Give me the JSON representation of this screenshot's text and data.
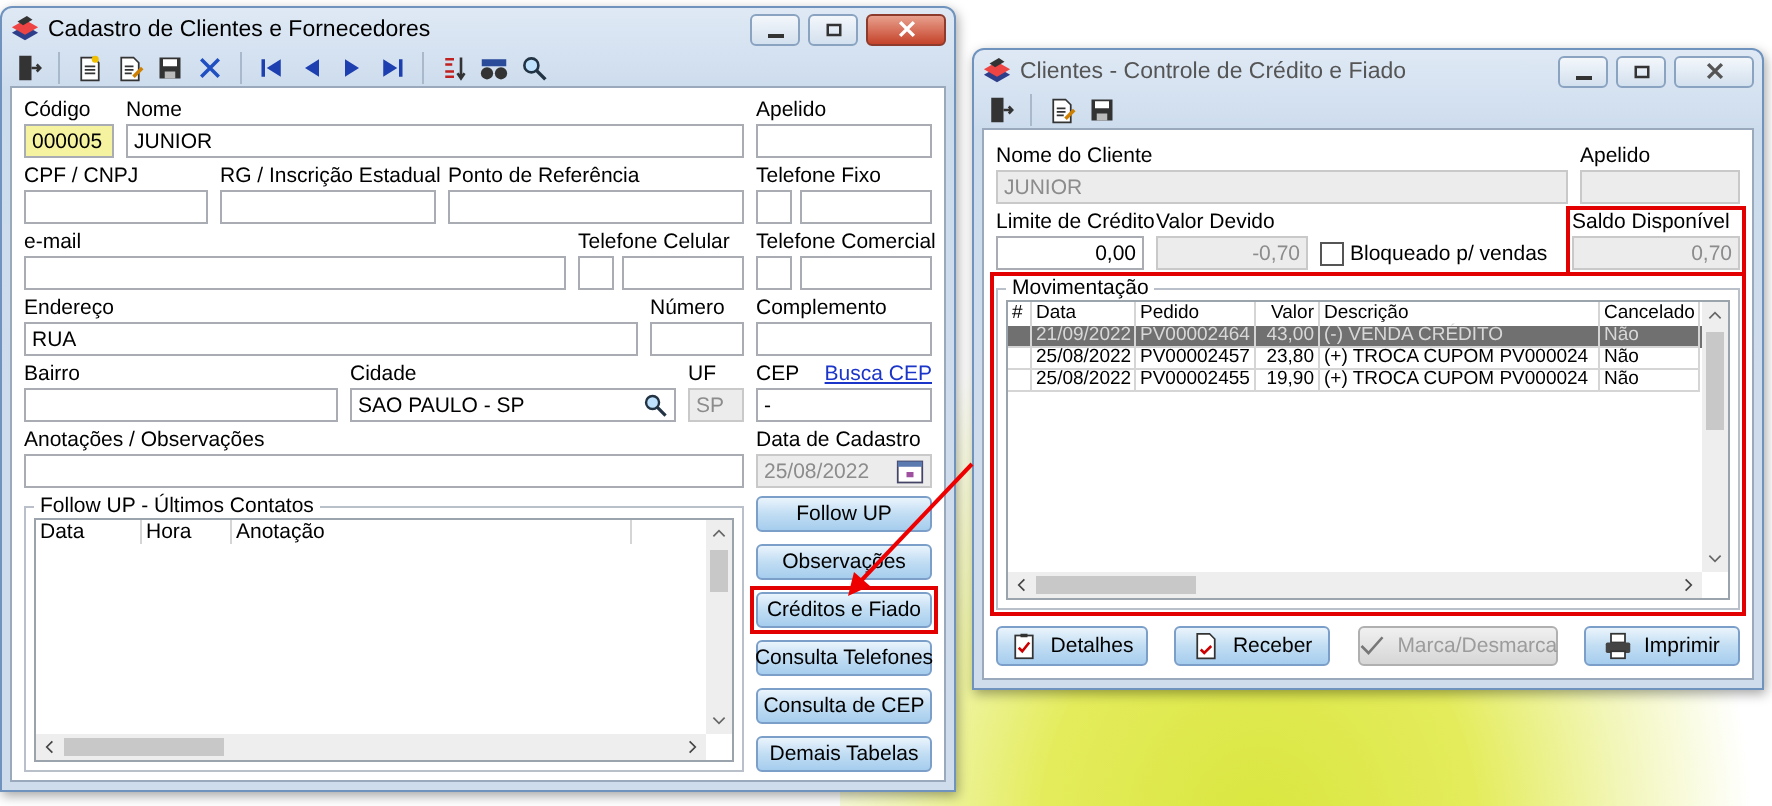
{
  "main_window": {
    "title": "Cadastro de Clientes e Fornecedores",
    "active": true,
    "fields": [
      {
        "label": "Código",
        "value": "000005",
        "kind": "text",
        "disabled": false,
        "focused": true
      },
      {
        "label": "Nome",
        "value": "JUNIOR",
        "kind": "text",
        "disabled": false,
        "focused": false
      },
      {
        "label": "Apelido",
        "kind": "text",
        "disabled": false,
        "focused": false
      },
      {
        "label": "CPF / CNPJ",
        "kind": "text",
        "disabled": false,
        "focused": false
      },
      {
        "label": "RG / Inscrição Estadual",
        "kind": "text",
        "disabled": false,
        "focused": false
      },
      {
        "label": "Ponto de Referência",
        "kind": "text",
        "disabled": false,
        "focused": false
      },
      {
        "label": "Telefone Fixo",
        "kind": "phone",
        "disabled": false,
        "focused": false
      },
      {
        "label": "e-mail",
        "kind": "text",
        "disabled": false,
        "focused": false
      },
      {
        "label": "Telefone Celular",
        "kind": "phone",
        "disabled": false,
        "focused": false
      },
      {
        "label": "Telefone Comercial",
        "kind": "phone",
        "disabled": false,
        "focused": false
      },
      {
        "label": "Endereço",
        "value": "RUA",
        "kind": "text",
        "disabled": false,
        "focused": false
      },
      {
        "label": "Número",
        "kind": "text",
        "disabled": false,
        "focused": false
      },
      {
        "label": "Complemento",
        "kind": "text",
        "disabled": false,
        "focused": false
      },
      {
        "label": "Bairro",
        "kind": "text",
        "disabled": false,
        "focused": false
      },
      {
        "label": "Cidade",
        "value": "SAO PAULO - SP",
        "kind": "search",
        "disabled": false,
        "focused": false
      },
      {
        "label": "UF",
        "value": "SP",
        "kind": "text",
        "disabled": true,
        "focused": false
      },
      {
        "label": "CEP",
        "value": "-",
        "link": "Busca CEP",
        "kind": "text",
        "disabled": false,
        "focused": false
      },
      {
        "label": "Anotações / Observações",
        "kind": "text",
        "disabled": false,
        "focused": false
      },
      {
        "label": "Data de Cadastro",
        "value": "25/08/2022",
        "kind": "date",
        "disabled": true,
        "focused": false
      }
    ],
    "followup": {
      "title": "Follow UP - Últimos Contatos",
      "columns": [
        "Data",
        "Hora",
        "Anotação"
      ]
    },
    "side_buttons": [
      {
        "label": "Follow UP",
        "highlighted": false
      },
      {
        "label": "Observações",
        "highlighted": false
      },
      {
        "label": "Créditos e Fiado",
        "highlighted": true
      },
      {
        "label": "Consulta Telefones",
        "highlighted": false
      },
      {
        "label": "Consulta de CEP",
        "highlighted": false
      },
      {
        "label": "Demais Tabelas",
        "highlighted": false
      }
    ]
  },
  "credit_window": {
    "title": "Clientes - Controle de Crédito e Fiado",
    "active": false,
    "fields": [
      {
        "label": "Nome do Cliente",
        "value": "JUNIOR",
        "kind": "text",
        "disabled": true,
        "highlighted": false
      },
      {
        "label": "Apelido",
        "kind": "text",
        "disabled": true,
        "highlighted": false
      },
      {
        "label": "Limite de Crédito",
        "value": "0,00",
        "kind": "number",
        "disabled": false,
        "highlighted": false
      },
      {
        "label": "Valor Devido",
        "value": "-0,70",
        "kind": "number",
        "disabled": true,
        "highlighted": false
      },
      {
        "label": "Bloqueado p/ vendas",
        "kind": "checkbox",
        "checked": false,
        "disabled": false,
        "highlighted": false
      },
      {
        "label": "Saldo Disponível",
        "value": "0,70",
        "kind": "number",
        "disabled": true,
        "highlighted": true
      }
    ],
    "movement": {
      "title": "Movimentação",
      "highlighted": true,
      "columns": [
        {
          "label": "#",
          "kind": "text"
        },
        {
          "label": "Data",
          "kind": "text"
        },
        {
          "label": "Pedido",
          "kind": "text"
        },
        {
          "label": "Valor",
          "kind": "number"
        },
        {
          "label": "Descrição",
          "kind": "text"
        },
        {
          "label": "Cancelado",
          "kind": "text"
        }
      ],
      "rows": [
        {
          "selected": true,
          "cells": [
            "",
            "21/09/2022",
            "PV00002464",
            "43,00",
            "(-) VENDA CRÉDITO",
            "Não"
          ]
        },
        {
          "selected": false,
          "cells": [
            "",
            "25/08/2022",
            "PV00002457",
            "23,80",
            "(+) TROCA CUPOM PV000024",
            "Não"
          ]
        },
        {
          "selected": false,
          "cells": [
            "",
            "25/08/2022",
            "PV00002455",
            "19,90",
            "(+) TROCA CUPOM PV000024",
            "Não"
          ]
        }
      ]
    },
    "buttons": [
      {
        "label": "Detalhes",
        "disabled": false
      },
      {
        "label": "Receber",
        "disabled": false
      },
      {
        "label": "Marca/Desmarca",
        "disabled": true
      },
      {
        "label": "Imprimir",
        "disabled": false
      }
    ]
  }
}
